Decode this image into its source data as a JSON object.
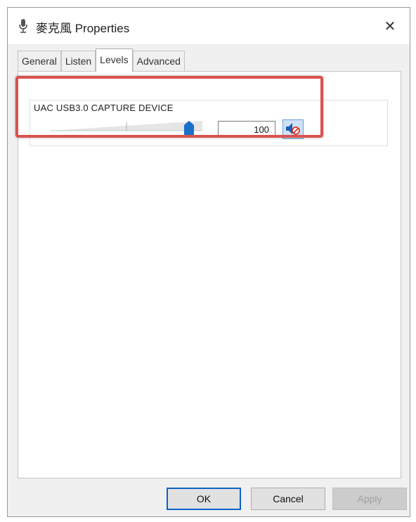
{
  "window": {
    "title": "麥克風 Properties",
    "title_icon": "microphone-icon",
    "close_glyph": "✕"
  },
  "tabs": [
    {
      "label": "General",
      "active": false
    },
    {
      "label": "Listen",
      "active": false
    },
    {
      "label": "Levels",
      "active": true
    },
    {
      "label": "Advanced",
      "active": false
    }
  ],
  "levels": {
    "device_name": "UAC USB3.0 CAPTURE DEVICE",
    "level_value": "100",
    "level_fraction": 1.0,
    "mute_icon": "speaker-muted-icon"
  },
  "buttons": {
    "ok": "OK",
    "cancel": "Cancel",
    "apply": "Apply"
  },
  "colors": {
    "highlight": "#d9534f",
    "accent": "#0a64c8",
    "thumb": "#1a6fc9"
  }
}
